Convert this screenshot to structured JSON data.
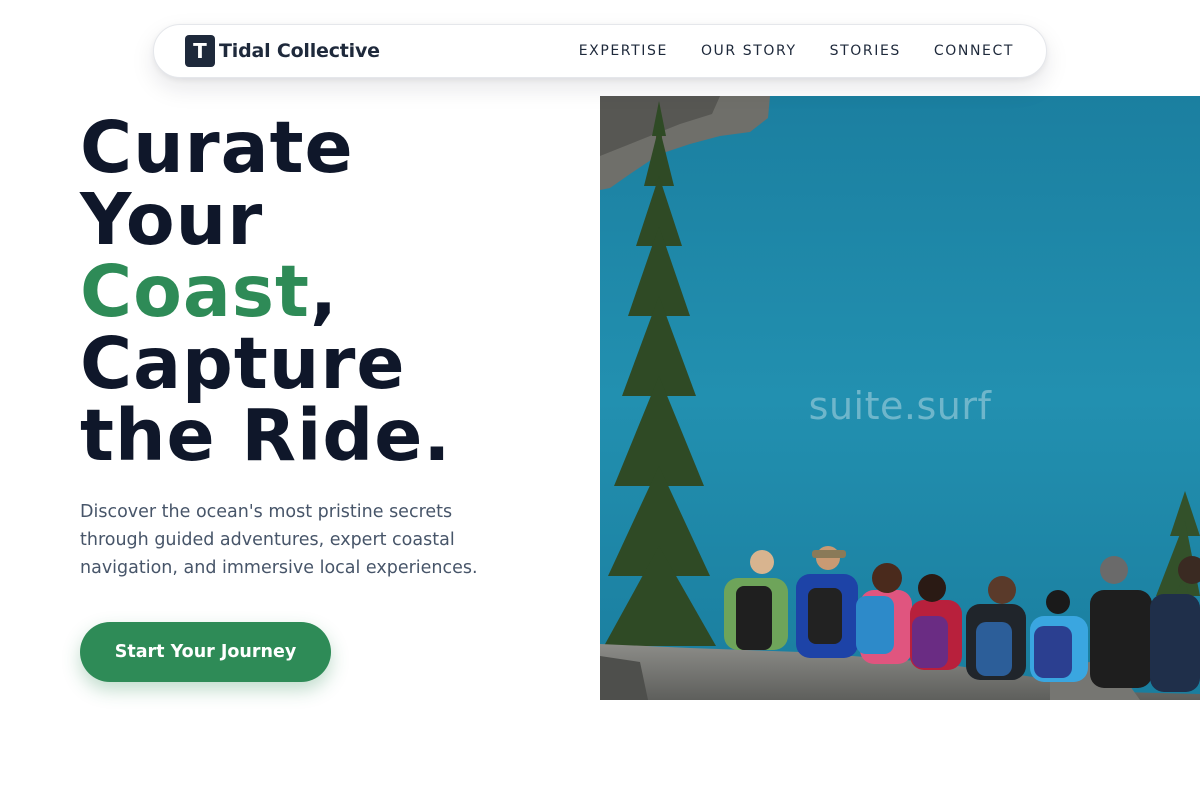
{
  "brand": {
    "mark": "T",
    "name": "Tidal Collective"
  },
  "nav": {
    "items": [
      "EXPERTISE",
      "OUR STORY",
      "STORIES",
      "CONNECT"
    ]
  },
  "hero": {
    "title_line1": "Curate",
    "title_line2": "Your",
    "title_accent": "Coast",
    "title_comma": ",",
    "title_line4": "Capture",
    "title_line5": "the Ride.",
    "subtitle": "Discover the ocean's most pristine secrets through guided adventures, expert coastal navigation, and immersive local experiences.",
    "cta_label": "Start Your Journey"
  },
  "image": {
    "watermark": "suite.surf"
  },
  "colors": {
    "accent": "#2e8b57",
    "heading": "#0f172a",
    "body_text": "#475569",
    "lake": "#1f88a8"
  }
}
